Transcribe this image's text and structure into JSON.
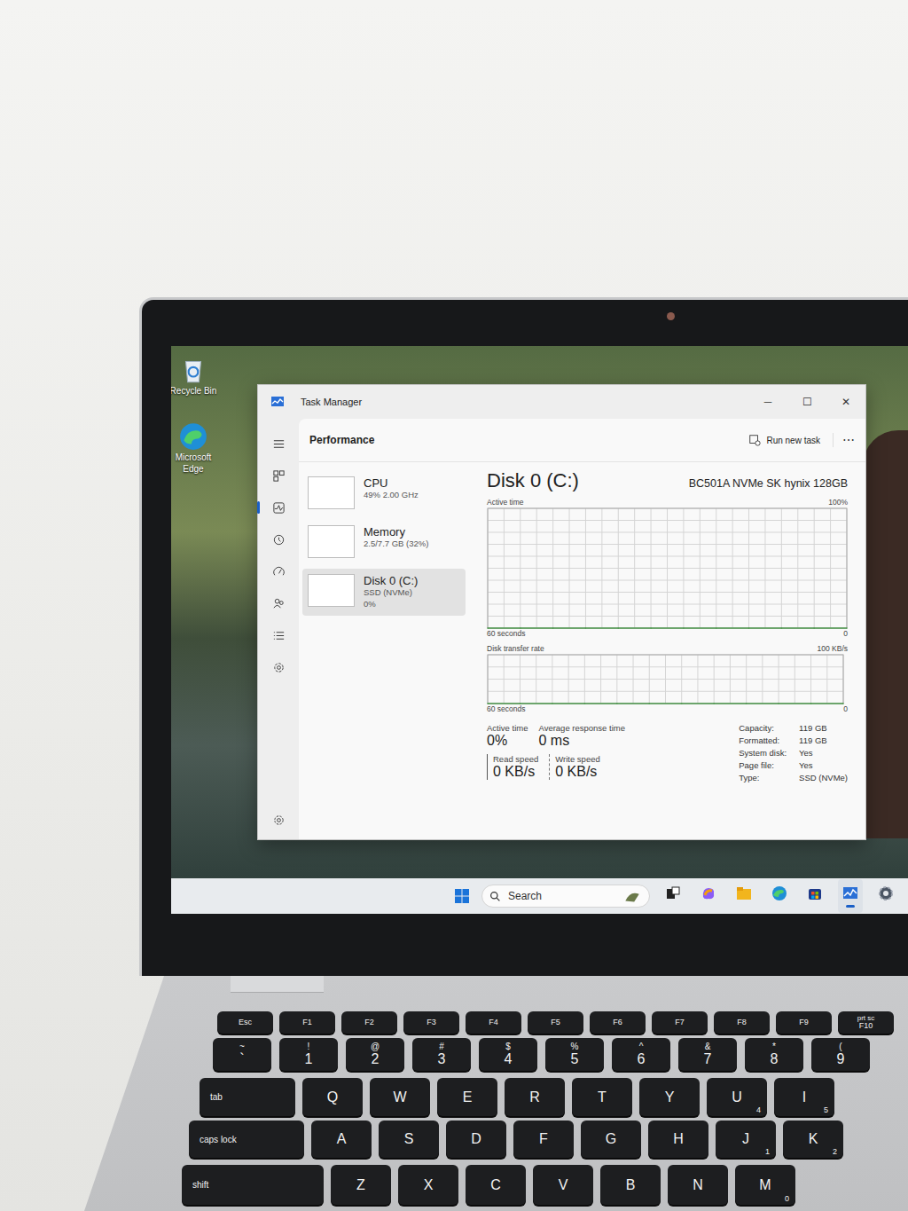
{
  "desktop": {
    "icons": [
      {
        "label": "Recycle Bin",
        "kind": "recycle"
      },
      {
        "label": "Microsoft Edge",
        "kind": "edge"
      }
    ]
  },
  "window": {
    "title": "Task Manager",
    "controls": [
      "─",
      "☐",
      "✕"
    ]
  },
  "nav": [
    {
      "kind": "menu",
      "selected": false
    },
    {
      "kind": "processes",
      "selected": false
    },
    {
      "kind": "performance",
      "selected": true
    },
    {
      "kind": "history",
      "selected": false
    },
    {
      "kind": "startup",
      "selected": false
    },
    {
      "kind": "users",
      "selected": false
    },
    {
      "kind": "details",
      "selected": false
    },
    {
      "kind": "services",
      "selected": false
    },
    {
      "kind": "settings",
      "selected": false
    }
  ],
  "header": {
    "title": "Performance",
    "run_task": "Run new task",
    "more": "⋯"
  },
  "resources": [
    {
      "name": "CPU",
      "lines": [
        "49% 2.00 GHz"
      ],
      "selected": false
    },
    {
      "name": "Memory",
      "lines": [
        "2.5/7.7 GB (32%)"
      ],
      "selected": false
    },
    {
      "name": "Disk 0 (C:)",
      "lines": [
        "SSD (NVMe)",
        "0%"
      ],
      "selected": true
    }
  ],
  "detail": {
    "title": "Disk 0 (C:)",
    "model": "BC501A NVMe SK hynix 128GB",
    "charts": [
      {
        "label": "Active time",
        "max_label": "100%",
        "time_label": "60 seconds",
        "min_label": "0",
        "values": [
          0,
          0,
          0,
          0,
          0,
          0,
          0,
          0,
          0,
          0,
          0,
          0
        ]
      },
      {
        "label": "Disk transfer rate",
        "max_label": "100 KB/s",
        "time_label": "60 seconds",
        "min_label": "0",
        "values": [
          0,
          0,
          0,
          0,
          0,
          0,
          0,
          0,
          0,
          0,
          0,
          0
        ]
      }
    ],
    "stats": [
      {
        "label": "Active time",
        "value": "0%"
      },
      {
        "label": "Average response time",
        "value": "0 ms"
      }
    ],
    "speeds": [
      {
        "label": "Read speed",
        "value": "0 KB/s"
      },
      {
        "label": "Write speed",
        "value": "0 KB/s"
      }
    ],
    "properties": [
      {
        "label": "Capacity:",
        "value": "119 GB"
      },
      {
        "label": "Formatted:",
        "value": "119 GB"
      },
      {
        "label": "System disk:",
        "value": "Yes"
      },
      {
        "label": "Page file:",
        "value": "Yes"
      },
      {
        "label": "Type:",
        "value": "SSD (NVMe)"
      }
    ]
  },
  "taskbar": {
    "search": "Search",
    "apps": [
      {
        "kind": "taskview",
        "running": false
      },
      {
        "kind": "copilot",
        "running": false
      },
      {
        "kind": "explorer",
        "running": false
      },
      {
        "kind": "edge",
        "running": false
      },
      {
        "kind": "store",
        "running": false
      },
      {
        "kind": "taskmanager",
        "running": true
      },
      {
        "kind": "settings",
        "running": false
      }
    ]
  },
  "keyboard": [
    [
      {
        "top": "",
        "main": "Esc",
        "sub": ""
      },
      {
        "top": "",
        "main": "F1",
        "sub": ""
      },
      {
        "top": "",
        "main": "F2",
        "sub": ""
      },
      {
        "top": "",
        "main": "F3",
        "sub": ""
      },
      {
        "top": "",
        "main": "F4",
        "sub": ""
      },
      {
        "top": "",
        "main": "F5",
        "sub": ""
      },
      {
        "top": "",
        "main": "F6",
        "sub": ""
      },
      {
        "top": "",
        "main": "F7",
        "sub": ""
      },
      {
        "top": "",
        "main": "F8",
        "sub": ""
      },
      {
        "top": "",
        "main": "F9",
        "sub": ""
      },
      {
        "top": "prt sc",
        "main": "F10",
        "sub": ""
      }
    ],
    [
      {
        "top": "~",
        "main": "`",
        "sub": ""
      },
      {
        "top": "!",
        "main": "1",
        "sub": ""
      },
      {
        "top": "@",
        "main": "2",
        "sub": ""
      },
      {
        "top": "#",
        "main": "3",
        "sub": ""
      },
      {
        "top": "$",
        "main": "4",
        "sub": ""
      },
      {
        "top": "%",
        "main": "5",
        "sub": ""
      },
      {
        "top": "^",
        "main": "6",
        "sub": ""
      },
      {
        "top": "&",
        "main": "7",
        "sub": ""
      },
      {
        "top": "*",
        "main": "8",
        "sub": ""
      },
      {
        "top": "(",
        "main": "9",
        "sub": ""
      }
    ],
    [
      {
        "top": "",
        "main": "tab",
        "sub": ""
      },
      {
        "top": "",
        "main": "Q",
        "sub": ""
      },
      {
        "top": "",
        "main": "W",
        "sub": ""
      },
      {
        "top": "",
        "main": "E",
        "sub": ""
      },
      {
        "top": "",
        "main": "R",
        "sub": ""
      },
      {
        "top": "",
        "main": "T",
        "sub": ""
      },
      {
        "top": "",
        "main": "Y",
        "sub": ""
      },
      {
        "top": "",
        "main": "U",
        "sub": "4"
      },
      {
        "top": "",
        "main": "I",
        "sub": "5"
      }
    ],
    [
      {
        "top": "",
        "main": "caps lock",
        "sub": ""
      },
      {
        "top": "",
        "main": "A",
        "sub": ""
      },
      {
        "top": "",
        "main": "S",
        "sub": ""
      },
      {
        "top": "",
        "main": "D",
        "sub": ""
      },
      {
        "top": "",
        "main": "F",
        "sub": ""
      },
      {
        "top": "",
        "main": "G",
        "sub": ""
      },
      {
        "top": "",
        "main": "H",
        "sub": ""
      },
      {
        "top": "",
        "main": "J",
        "sub": "1"
      },
      {
        "top": "",
        "main": "K",
        "sub": "2"
      }
    ],
    [
      {
        "top": "",
        "main": "shift",
        "sub": ""
      },
      {
        "top": "",
        "main": "Z",
        "sub": ""
      },
      {
        "top": "",
        "main": "X",
        "sub": ""
      },
      {
        "top": "",
        "main": "C",
        "sub": ""
      },
      {
        "top": "",
        "main": "V",
        "sub": ""
      },
      {
        "top": "",
        "main": "B",
        "sub": ""
      },
      {
        "top": "",
        "main": "N",
        "sub": ""
      },
      {
        "top": "",
        "main": "M",
        "sub": "0"
      }
    ]
  ]
}
